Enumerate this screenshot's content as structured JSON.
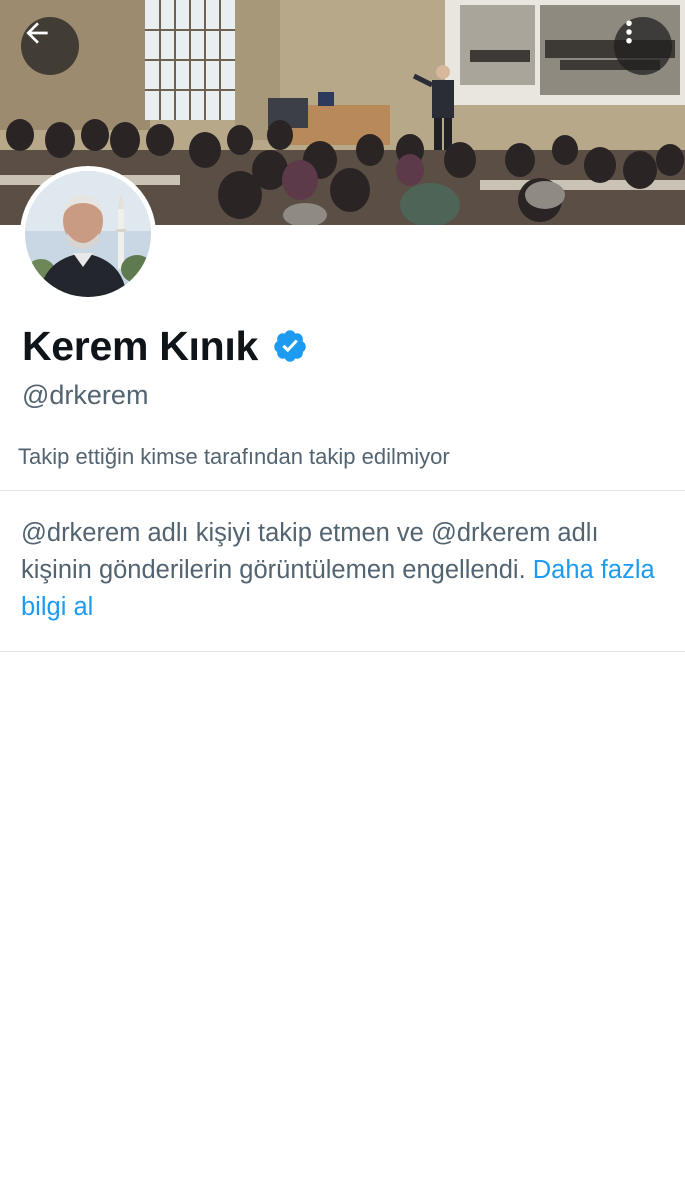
{
  "header": {
    "back_icon": "arrow-left-icon",
    "more_icon": "more-vertical-icon"
  },
  "profile": {
    "display_name": "Kerem Kınık",
    "verified_icon": "verified-badge-icon",
    "verified_color": "#1d9bf0",
    "handle": "@drkerem",
    "follow_info": "Takip ettiğin kimse tarafından takip edilmiyor"
  },
  "blocked": {
    "message": "@drkerem adlı kişiyi takip etmen ve @drkerem adlı kişinin gönderilerin görüntülemen engellendi.",
    "link_text": "Daha fazla bilgi al",
    "link_color": "#1d9bf0"
  }
}
